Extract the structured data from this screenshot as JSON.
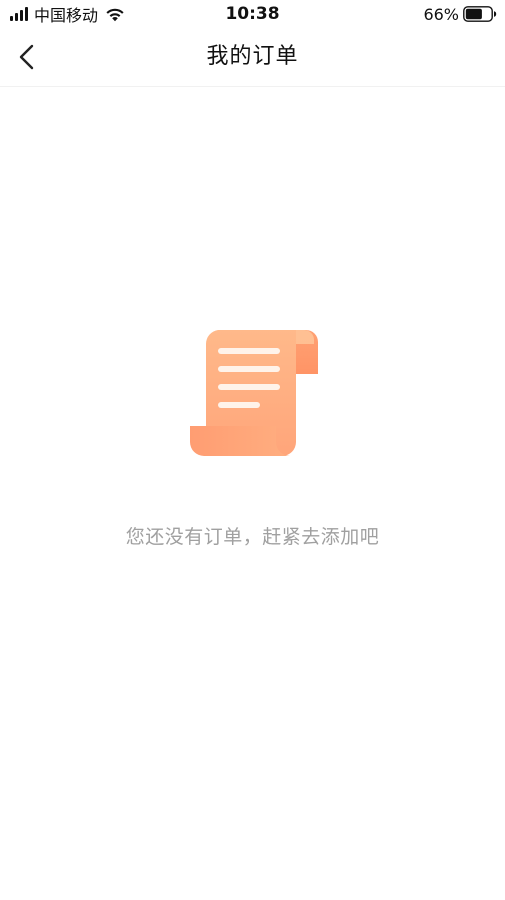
{
  "status_bar": {
    "carrier": "中国移动",
    "time": "10:38",
    "battery_percent": "66%",
    "battery_level": 0.66,
    "icons": {
      "signal": "cellular-signal-icon",
      "wifi": "wifi-icon",
      "battery": "battery-icon"
    }
  },
  "nav": {
    "title": "我的订单",
    "back_icon": "chevron-left-icon"
  },
  "empty_state": {
    "illustration": "scroll-document-icon",
    "message": "您还没有订单，赶紧去添加吧"
  },
  "colors": {
    "accent_light": "#FFB98A",
    "accent_dark": "#FF9F74",
    "message_text": "#A0A0A0",
    "divider": "#F1F1F1"
  }
}
